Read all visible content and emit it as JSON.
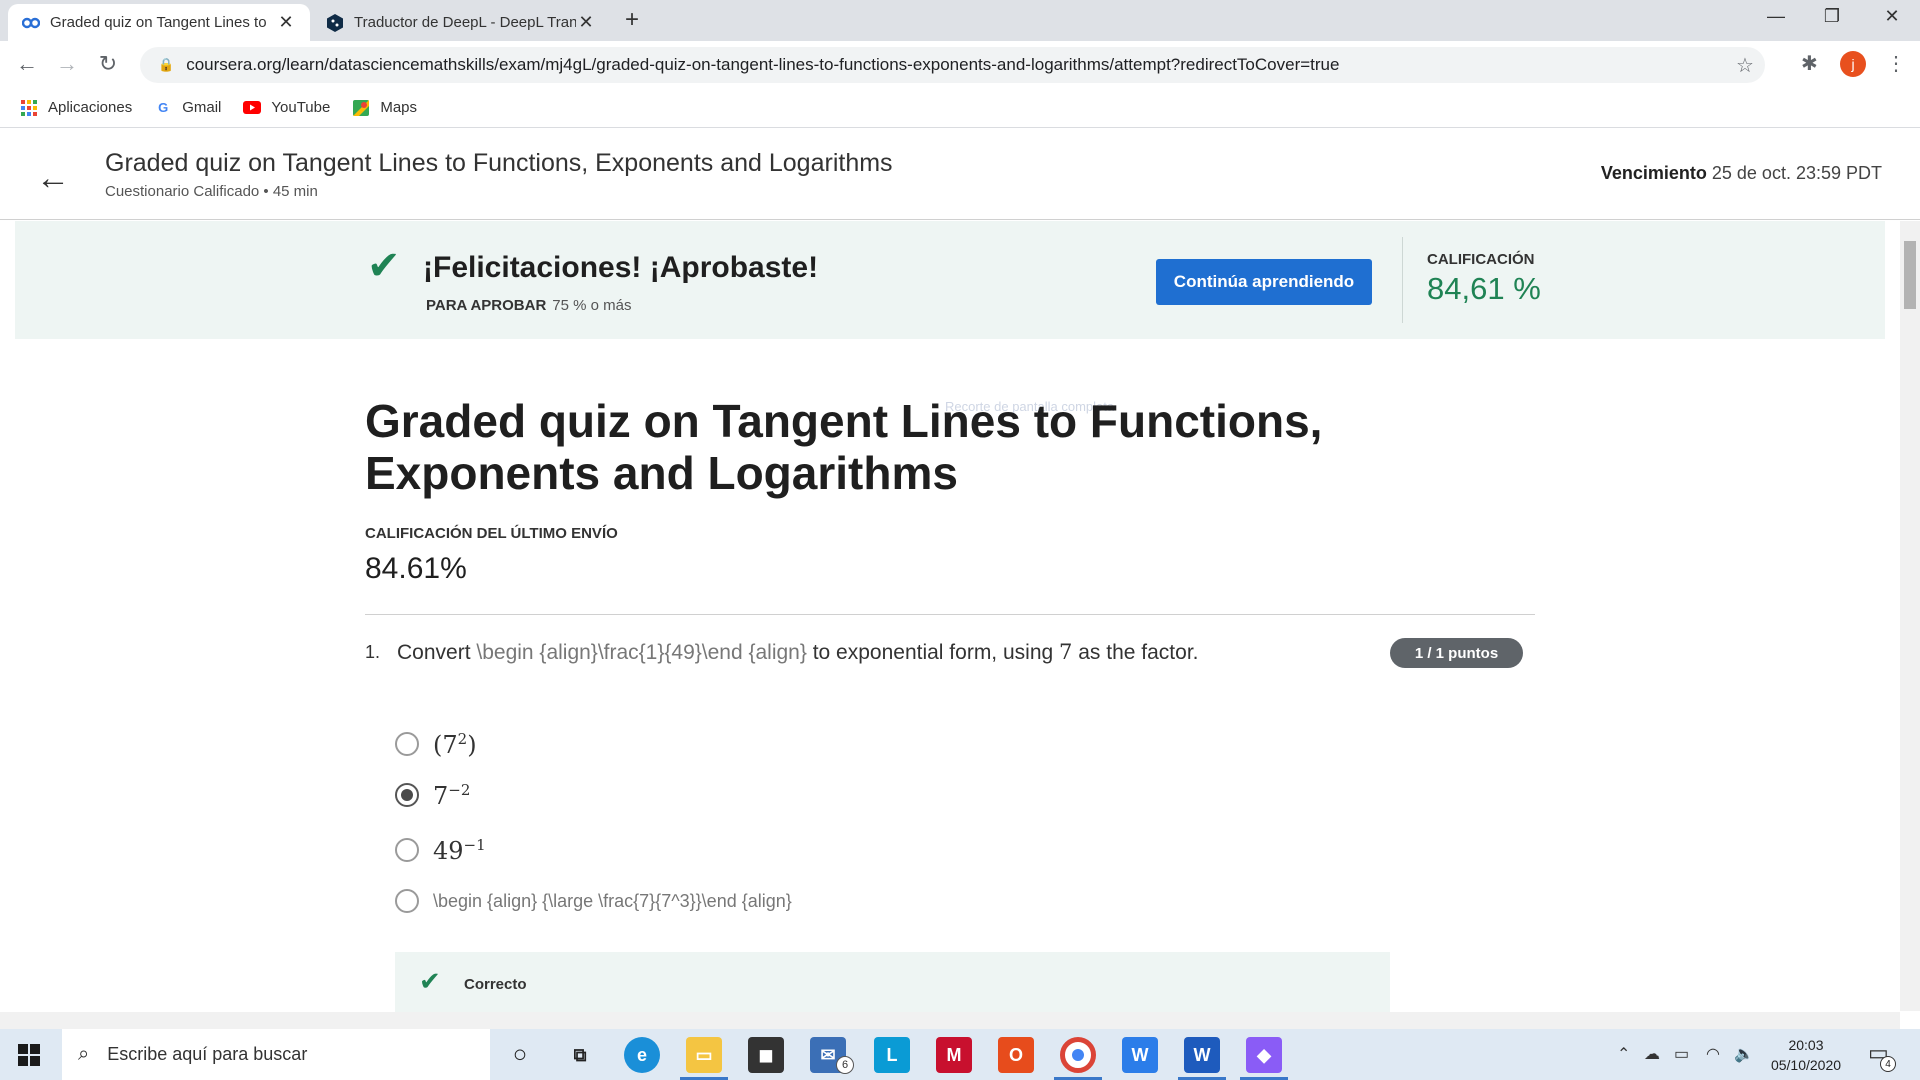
{
  "browser": {
    "tabs": [
      {
        "title": "Graded quiz on Tangent Lines to",
        "favicon": "coursera-icon"
      },
      {
        "title": "Traductor de DeepL - DeepL Tran",
        "favicon": "deepl-icon"
      }
    ],
    "url": "coursera.org/learn/datasciencemathskills/exam/mj4gL/graded-quiz-on-tangent-lines-to-functions-exponents-and-logarithms/attempt?redirectToCover=true",
    "profile_initial": "j",
    "bookmarks": [
      {
        "label": "Aplicaciones",
        "icon": "apps-grid-icon"
      },
      {
        "label": "Gmail",
        "icon": "google-icon"
      },
      {
        "label": "YouTube",
        "icon": "youtube-icon"
      },
      {
        "label": "Maps",
        "icon": "maps-icon"
      }
    ]
  },
  "header": {
    "title": "Graded quiz on Tangent Lines to Functions, Exponents and Logarithms",
    "subtitle": "Cuestionario Calificado • 45 min",
    "due_label": "Vencimiento",
    "due_value": "25 de oct. 23:59 PDT"
  },
  "banner": {
    "message": "¡Felicitaciones! ¡Aprobaste!",
    "pass_label": "PARA APROBAR",
    "pass_value": "75 % o más",
    "button": "Continúa aprendiendo",
    "grade_label": "CALIFICACIÓN",
    "grade_value": "84,61 %",
    "accent": "#1f8354",
    "button_color": "#1f6fd1"
  },
  "main": {
    "faint_text": "Recorte de pantalla completa",
    "title": "Graded quiz on Tangent Lines to Functions, Exponents and Logarithms",
    "last_label": "CALIFICACIÓN DEL ÚLTIMO ENVÍO",
    "last_value": "84.61%"
  },
  "question": {
    "number": "1.",
    "text_before": "Convert",
    "raw": "\\begin {align}\\frac{1}{49}\\end {align}",
    "text_middle": "to exponential form, using",
    "factor": "7",
    "text_after": "as the factor.",
    "points": "1 / 1 puntos",
    "options": [
      {
        "base": "(7",
        "exp": "2",
        "close": ")",
        "selected": false
      },
      {
        "base": "7",
        "exp": "−2",
        "close": "",
        "selected": true
      },
      {
        "base": "49",
        "exp": "−1",
        "close": "",
        "selected": false
      }
    ],
    "option_raw": "\\begin {align} {\\large \\frac{7}{7^3}}\\end {align}",
    "feedback": "Correcto"
  },
  "taskbar": {
    "search_placeholder": "Escribe aquí para buscar",
    "mail_badge": "6",
    "time": "20:03",
    "date": "05/10/2020",
    "notifications": "4"
  }
}
